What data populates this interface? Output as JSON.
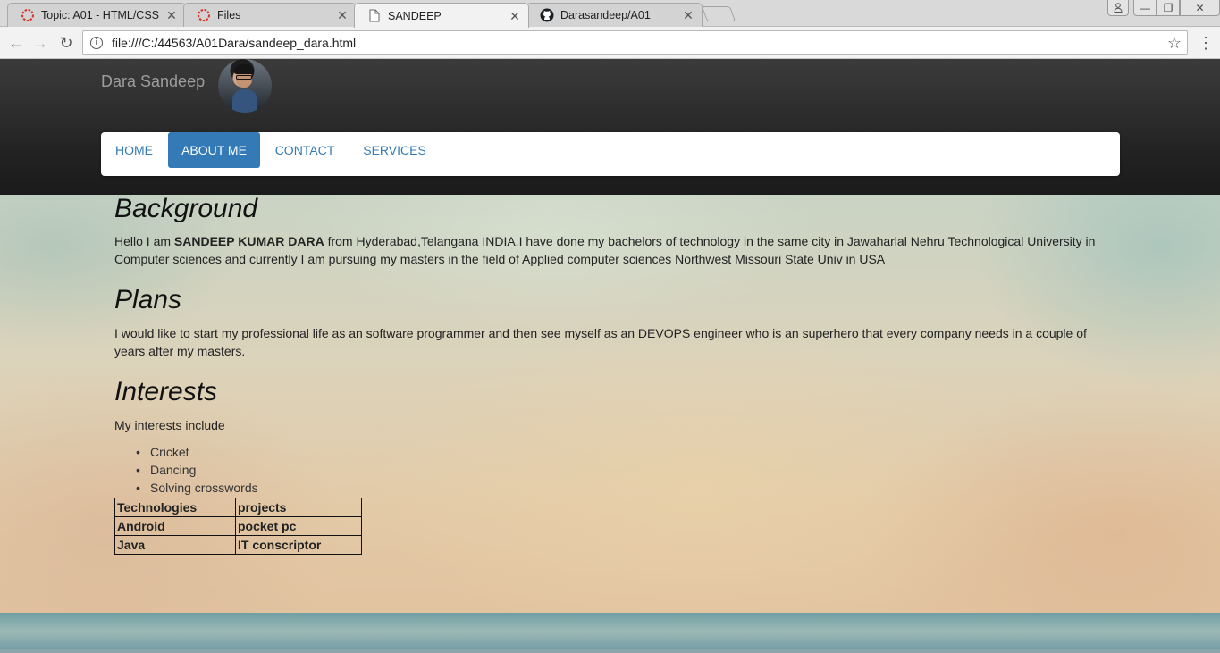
{
  "browser": {
    "tabs": [
      {
        "title": "Topic: A01 - HTML/CSS",
        "icon": "loading-ring-icon"
      },
      {
        "title": "Files",
        "icon": "loading-ring-icon"
      },
      {
        "title": "SANDEEP",
        "icon": "page-icon"
      },
      {
        "title": "Darasandeep/A01",
        "icon": "github-icon"
      }
    ],
    "close_glyph": "✕",
    "url": "file:///C:/44563/A01Dara/sandeep_dara.html",
    "info_glyph": "i",
    "star_glyph": "☆",
    "menu_glyph": "⋮",
    "back_glyph": "←",
    "forward_glyph": "→",
    "reload_glyph": "↻",
    "profile_glyph": "👤",
    "min_glyph": "—",
    "max_glyph": "❐",
    "winclose_glyph": "✕"
  },
  "header": {
    "brand": "Dara Sandeep",
    "nav": {
      "home": "HOME",
      "about": "ABOUT ME",
      "contact": "CONTACT",
      "services": "SERVICES"
    },
    "active_nav": "about",
    "accent_color": "#337ab7"
  },
  "content": {
    "background": {
      "heading": "Background",
      "intro": "Hello I am ",
      "name": "SANDEEP KUMAR DARA",
      "rest": " from Hyderabad,Telangana INDIA.I have done my bachelors of technology in the same city in Jawaharlal Nehru Technological University in Computer sciences and currently I am pursuing my masters in the field of Applied computer sciences Northwest Missouri State Univ in USA"
    },
    "plans": {
      "heading": "Plans",
      "text": "I would like to start my professional life as an software programmer and then see myself as an DEVOPS engineer who is an superhero that every company needs in a couple of years after my masters."
    },
    "interests": {
      "heading": "Interests",
      "intro": "My interests include",
      "items": [
        "Cricket",
        "Dancing",
        "Solving crosswords"
      ]
    },
    "table": {
      "headers": [
        "Technologies",
        "projects"
      ],
      "rows": [
        [
          "Android",
          "pocket pc"
        ],
        [
          "Java",
          "IT conscriptor"
        ]
      ]
    }
  }
}
